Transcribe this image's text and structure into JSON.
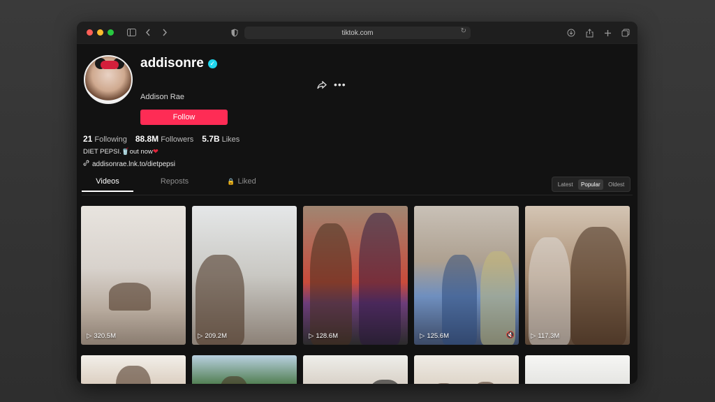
{
  "browser": {
    "url": "tiktok.com"
  },
  "profile": {
    "username": "addisonre",
    "display_name": "Addison Rae",
    "follow_label": "Follow",
    "stats": [
      {
        "value": "21",
        "label": "Following"
      },
      {
        "value": "88.8M",
        "label": "Followers"
      },
      {
        "value": "5.7B",
        "label": "Likes"
      }
    ],
    "bio": "DIET PEPSI.",
    "bio_suffix": "out now",
    "link": "addisonrae.lnk.to/dietpepsi"
  },
  "tabs": {
    "videos": "Videos",
    "reposts": "Reposts",
    "liked": "Liked"
  },
  "sort": {
    "latest": "Latest",
    "popular": "Popular",
    "oldest": "Oldest"
  },
  "videos": [
    {
      "views": "320.5M"
    },
    {
      "views": "209.2M"
    },
    {
      "views": "128.6M"
    },
    {
      "views": "125.6M"
    },
    {
      "views": "117.3M"
    }
  ]
}
